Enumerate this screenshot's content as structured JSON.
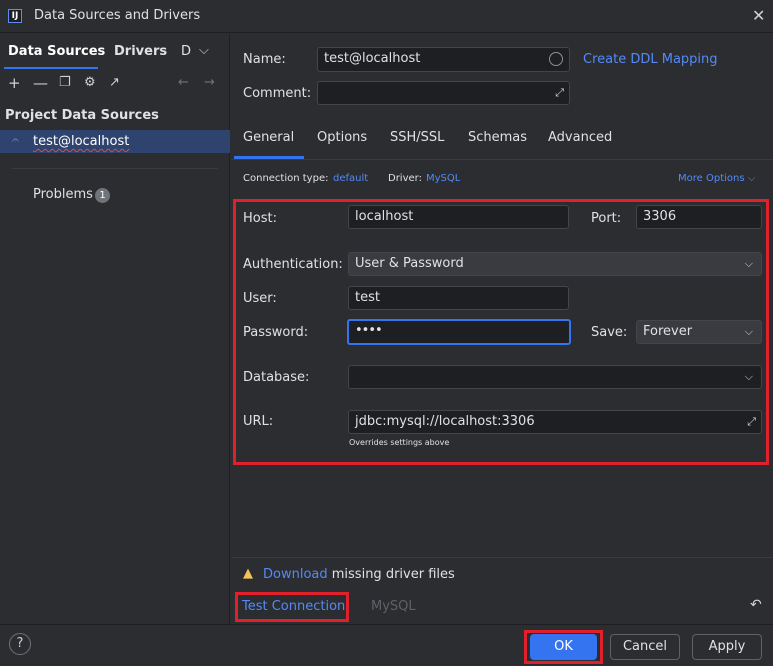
{
  "window": {
    "title": "Data Sources and Drivers",
    "app_icon": "IJ"
  },
  "left_panel": {
    "tabs": [
      "Data Sources",
      "Drivers",
      "D"
    ],
    "section_title": "Project Data Sources",
    "data_source": "test@localhost",
    "problems_label": "Problems",
    "problems_count": "1"
  },
  "header": {
    "name_label": "Name:",
    "name_value": "test@localhost",
    "comment_label": "Comment:",
    "comment_value": "",
    "ddl_link": "Create DDL Mapping"
  },
  "tabs": [
    "General",
    "Options",
    "SSH/SSL",
    "Schemas",
    "Advanced"
  ],
  "connection_info": {
    "type_label": "Connection type:",
    "type_value": "default",
    "driver_label": "Driver:",
    "driver_value": "MySQL",
    "more_options": "More Options"
  },
  "form": {
    "host_label": "Host:",
    "host_value": "localhost",
    "port_label": "Port:",
    "port_value": "3306",
    "auth_label": "Authentication:",
    "auth_value": "User & Password",
    "user_label": "User:",
    "user_value": "test",
    "password_label": "Password:",
    "password_value": "••••",
    "save_label": "Save:",
    "save_value": "Forever",
    "database_label": "Database:",
    "database_value": "",
    "url_label": "URL:",
    "url_value": "jdbc:mysql://localhost:3306",
    "url_hint": "Overrides settings above"
  },
  "warning": {
    "link": "Download",
    "text": " missing driver files"
  },
  "footer_tabs": {
    "test_connection": "Test Connection",
    "driver": "MySQL"
  },
  "buttons": {
    "ok": "OK",
    "cancel": "Cancel",
    "apply": "Apply",
    "help": "?"
  },
  "colors": {
    "accent": "#3574f0",
    "link": "#548af7",
    "highlight_border": "#e0202a",
    "warning": "#f2c55c"
  }
}
